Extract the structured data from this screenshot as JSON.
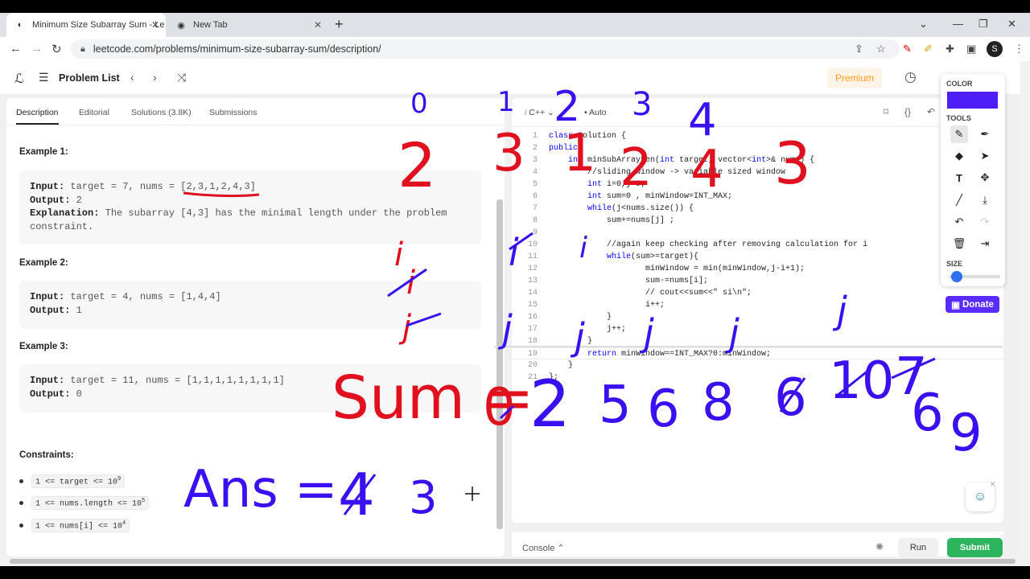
{
  "browser": {
    "tabs": [
      {
        "title": "Minimum Size Subarray Sum - Le",
        "active": true
      },
      {
        "title": "New Tab",
        "active": false
      }
    ],
    "url": "leetcode.com/problems/minimum-size-subarray-sum/description/",
    "profile_initial": "S"
  },
  "header": {
    "problem_list": "Problem List",
    "premium": "Premium"
  },
  "left": {
    "tabs": [
      "Description",
      "Editorial",
      "Solutions (3.8K)",
      "Submissions"
    ],
    "examples": [
      {
        "title": "Example 1:",
        "input_label": "Input:",
        "input": "target = 7, nums = [2,3,1,2,4,3]",
        "output_label": "Output:",
        "output": "2",
        "explanation_label": "Explanation:",
        "explanation": "The subarray [4,3] has the minimal length under the problem constraint."
      },
      {
        "title": "Example 2:",
        "input_label": "Input:",
        "input": "target = 4, nums = [1,4,4]",
        "output_label": "Output:",
        "output": "1"
      },
      {
        "title": "Example 3:",
        "input_label": "Input:",
        "input": "target = 11, nums = [1,1,1,1,1,1,1,1]",
        "output_label": "Output:",
        "output": "0"
      }
    ],
    "constraints_title": "Constraints:",
    "constraints": [
      {
        "text": "1 <= target <= 10",
        "sup": "9"
      },
      {
        "text": "1 <= nums.length <= 10",
        "sup": "5"
      },
      {
        "text": "1 <= nums[i] <= 10",
        "sup": "4"
      }
    ]
  },
  "editor": {
    "language": "C++",
    "auto": "Auto",
    "lines": [
      "class Solution {",
      "public:",
      "    int minSubArrayLen(int target, vector<int>& nums) {",
      "        //sliding window -> variable sized window",
      "        int i=0,j=0;",
      "        int sum=0 , minWindow=INT_MAX;",
      "        while(j<nums.size()) {",
      "            sum+=nums[j] ;",
      "",
      "            //again keep checking after removing calculation for i",
      "            while(sum>=target){",
      "                    minWindow = min(minWindow,j-i+1);",
      "                    sum-=nums[i];",
      "                    // cout<<sum<<\" si\\n\";",
      "                    i++;",
      "            }",
      "            j++;",
      "        }",
      "        return minWindow==INT_MAX?0:minWindow;",
      "    }",
      "};"
    ],
    "console": "Console",
    "run": "Run",
    "submit": "Submit"
  },
  "annotate": {
    "color_label": "COLOR",
    "tools_label": "TOOLS",
    "size_label": "SIZE",
    "color": "#4d1ff6",
    "size_fraction": 0.05,
    "donate": "Donate"
  },
  "drawings": {
    "indices": [
      "0",
      "1",
      "2",
      "3",
      "4"
    ],
    "nums": [
      "2",
      "3",
      "1",
      "2",
      "4",
      "3"
    ],
    "pointers": [
      "i",
      "i",
      "i",
      "j",
      "j",
      "j",
      "j",
      "j",
      "j"
    ],
    "sum_label": "Sum =",
    "sum_values": [
      "0",
      "2",
      "5",
      "6",
      "8",
      "6",
      "10",
      "7",
      "6",
      "9"
    ],
    "answer_label": "Ans =",
    "answer_values": [
      "4",
      "3"
    ]
  }
}
